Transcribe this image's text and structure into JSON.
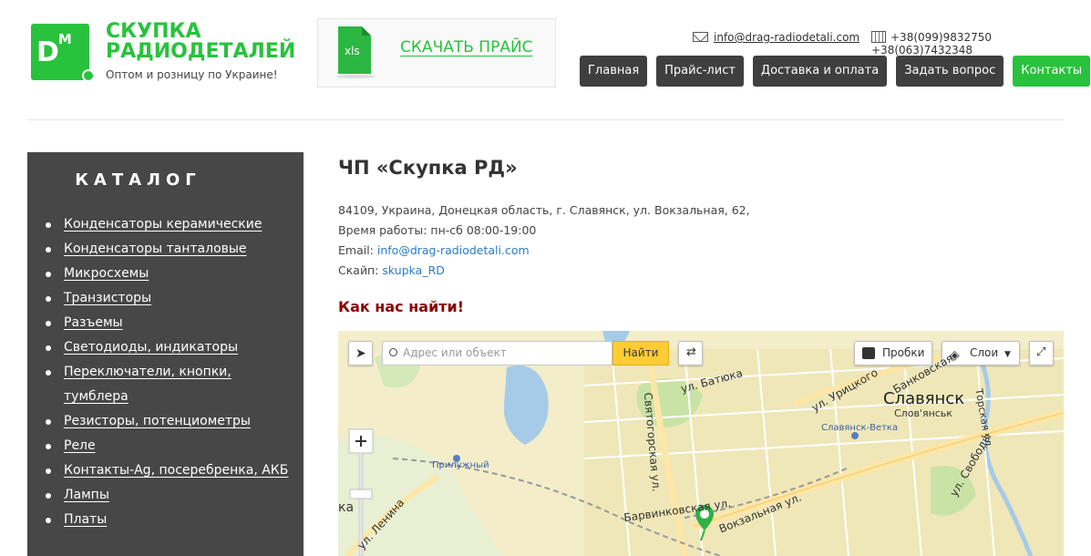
{
  "header": {
    "logo_text": "D",
    "logo_sup": "M",
    "brand_line1": "СКУПКА",
    "brand_line2": "РАДИОДЕТАЛЕЙ",
    "tagline": "Оптом и розницу по Украине!",
    "price_icon_text": "xls",
    "price_link": "СКАЧАТЬ ПРАЙС",
    "email": "info@drag-radiodetali.com",
    "phones": "+38(099)9832750 +38(063)7432348",
    "nav": [
      "Главная",
      "Прайс-лист",
      "Доставка и оплата",
      "Задать вопрос",
      "Контакты"
    ]
  },
  "sidebar": {
    "title": "КАТАЛОГ",
    "items": [
      "Конденсаторы керамические",
      "Конденсаторы танталовые",
      "Микросхемы",
      "Транзисторы",
      "Разъемы",
      "Светодиоды, индикаторы",
      "Переключатели, кнопки, тумблера",
      "Резисторы, потенциометры",
      "Реле",
      "Контакты-Ag, посеребренка, АКБ",
      "Лампы",
      "Платы"
    ]
  },
  "main": {
    "company": "ЧП «Скупка РД»",
    "address": "84109, Украина, Донецкая область, г. Славянск, ул. Вокзальная, 62,",
    "hours": "Время работы: пн-сб 08:00-19:00",
    "email_label": "Email: ",
    "email": "info@drag-radiodetali.com",
    "skype_label": "Скайп: ",
    "skype": "skupka_RD",
    "find_title": "Как нас найти!"
  },
  "map": {
    "search_placeholder": "Адрес или объект",
    "find_button": "Найти",
    "traffic_button": "Пробки",
    "layers_button": "Слои",
    "labels": {
      "city": "Славянск",
      "city_ua": "Слов'янськ",
      "station": "Славянск-Ветка",
      "pryluzhny": "Прилужный",
      "batyuka": "ул. Батюка",
      "uritskogo": "ул. Урицкого",
      "bankovskaya": "Банковская",
      "svyatogorskaya": "Святогорская ул.",
      "barvinkovskaya": "Барвинковская ул.",
      "vokzalnaya": "Вокзальная ул.",
      "lenina": "ул. Ленина",
      "svobody": "ул. Свободы",
      "torskaya": "Торская ул.",
      "edge_ka": "ка"
    },
    "colors": {
      "marker": "#2fb145",
      "water": "#a6cbe8",
      "park": "#c9e3a6"
    }
  }
}
